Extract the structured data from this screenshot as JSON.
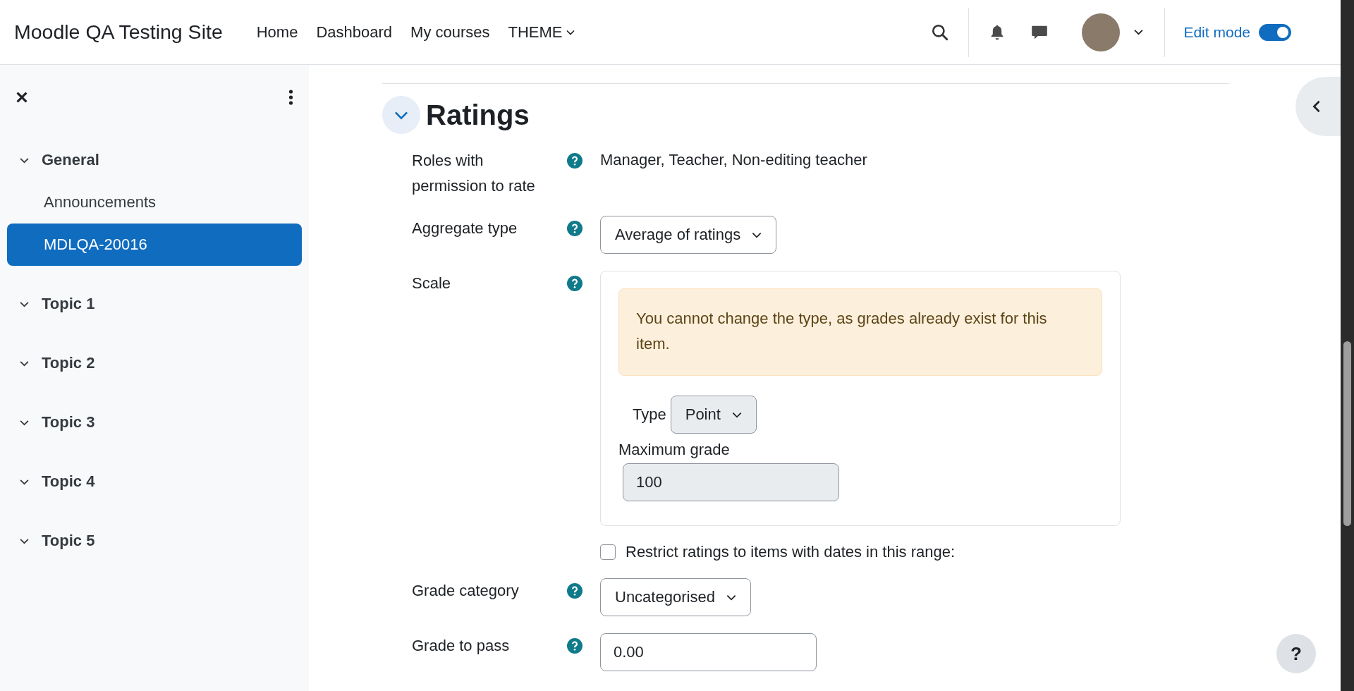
{
  "header": {
    "site_name": "Moodle QA Testing Site",
    "nav": [
      {
        "label": "Home",
        "has_menu": false
      },
      {
        "label": "Dashboard",
        "has_menu": false
      },
      {
        "label": "My courses",
        "has_menu": false
      },
      {
        "label": "THEME",
        "has_menu": true
      }
    ],
    "edit_mode": {
      "label": "Edit mode",
      "on": true
    }
  },
  "sidebar": {
    "items": [
      {
        "label": "General",
        "expanded": true,
        "selected": false,
        "children": [
          {
            "label": "Announcements",
            "selected": false
          },
          {
            "label": "MDLQA-20016",
            "selected": true
          }
        ]
      },
      {
        "label": "Topic 1",
        "expanded": true,
        "selected": false
      },
      {
        "label": "Topic 2",
        "expanded": true,
        "selected": false
      },
      {
        "label": "Topic 3",
        "expanded": true,
        "selected": false
      },
      {
        "label": "Topic 4",
        "expanded": true,
        "selected": false
      },
      {
        "label": "Topic 5",
        "expanded": true,
        "selected": false
      }
    ]
  },
  "section": {
    "title": "Ratings",
    "expanded": true,
    "fields": [
      {
        "kind": "static",
        "label": "Roles with permission to rate",
        "help": true,
        "value": "Manager, Teacher, Non-editing teacher"
      },
      {
        "kind": "select",
        "label": "Aggregate type",
        "help": true,
        "value": "Average of ratings"
      },
      {
        "kind": "scale",
        "label": "Scale",
        "help": true,
        "alert": "You cannot change the type, as grades already exist for this item.",
        "type_label": "Type",
        "type_value": "Point",
        "max_label": "Maximum grade",
        "max_value": "100",
        "disabled": true
      },
      {
        "kind": "checkbox",
        "label": "Restrict ratings to items with dates in this range:",
        "checked": false
      },
      {
        "kind": "select",
        "label": "Grade category",
        "help": true,
        "value": "Uncategorised"
      },
      {
        "kind": "text",
        "label": "Grade to pass",
        "help": true,
        "value": "0.00"
      }
    ]
  },
  "help_button": {
    "label": "?"
  }
}
